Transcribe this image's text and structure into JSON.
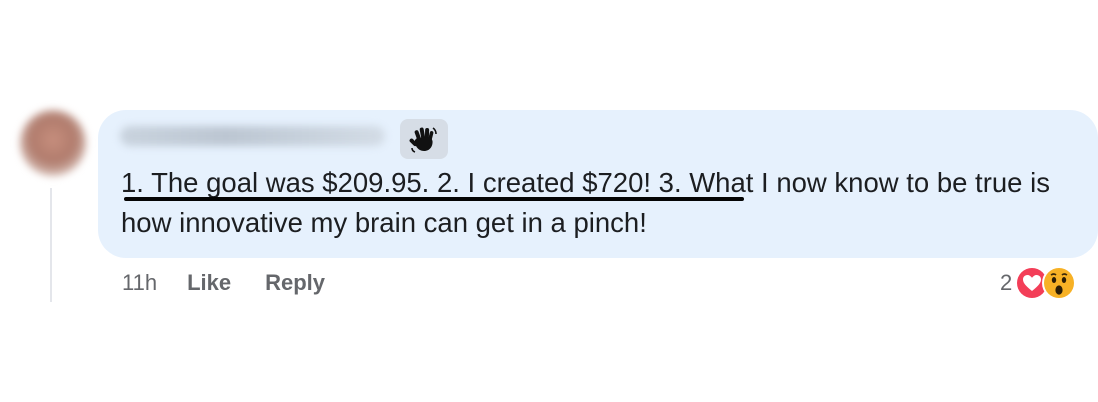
{
  "comment": {
    "author": {
      "name_hidden": true
    },
    "badge_icon": "waving-hand-icon",
    "text": "1. The goal was $209.95. 2. I created $720! 3. What I now know to be true is how innovative my brain can get in a pinch!",
    "meta": {
      "time": "11h",
      "like_label": "Like",
      "reply_label": "Reply"
    },
    "reactions": {
      "count": "2",
      "icons": [
        "love-reaction-icon",
        "wow-reaction-icon"
      ]
    }
  },
  "colors": {
    "bubble": "#e6f1fd",
    "text": "#1c1e21",
    "meta": "#65676b",
    "love": "#f33e58",
    "wow": "#f7b125"
  }
}
